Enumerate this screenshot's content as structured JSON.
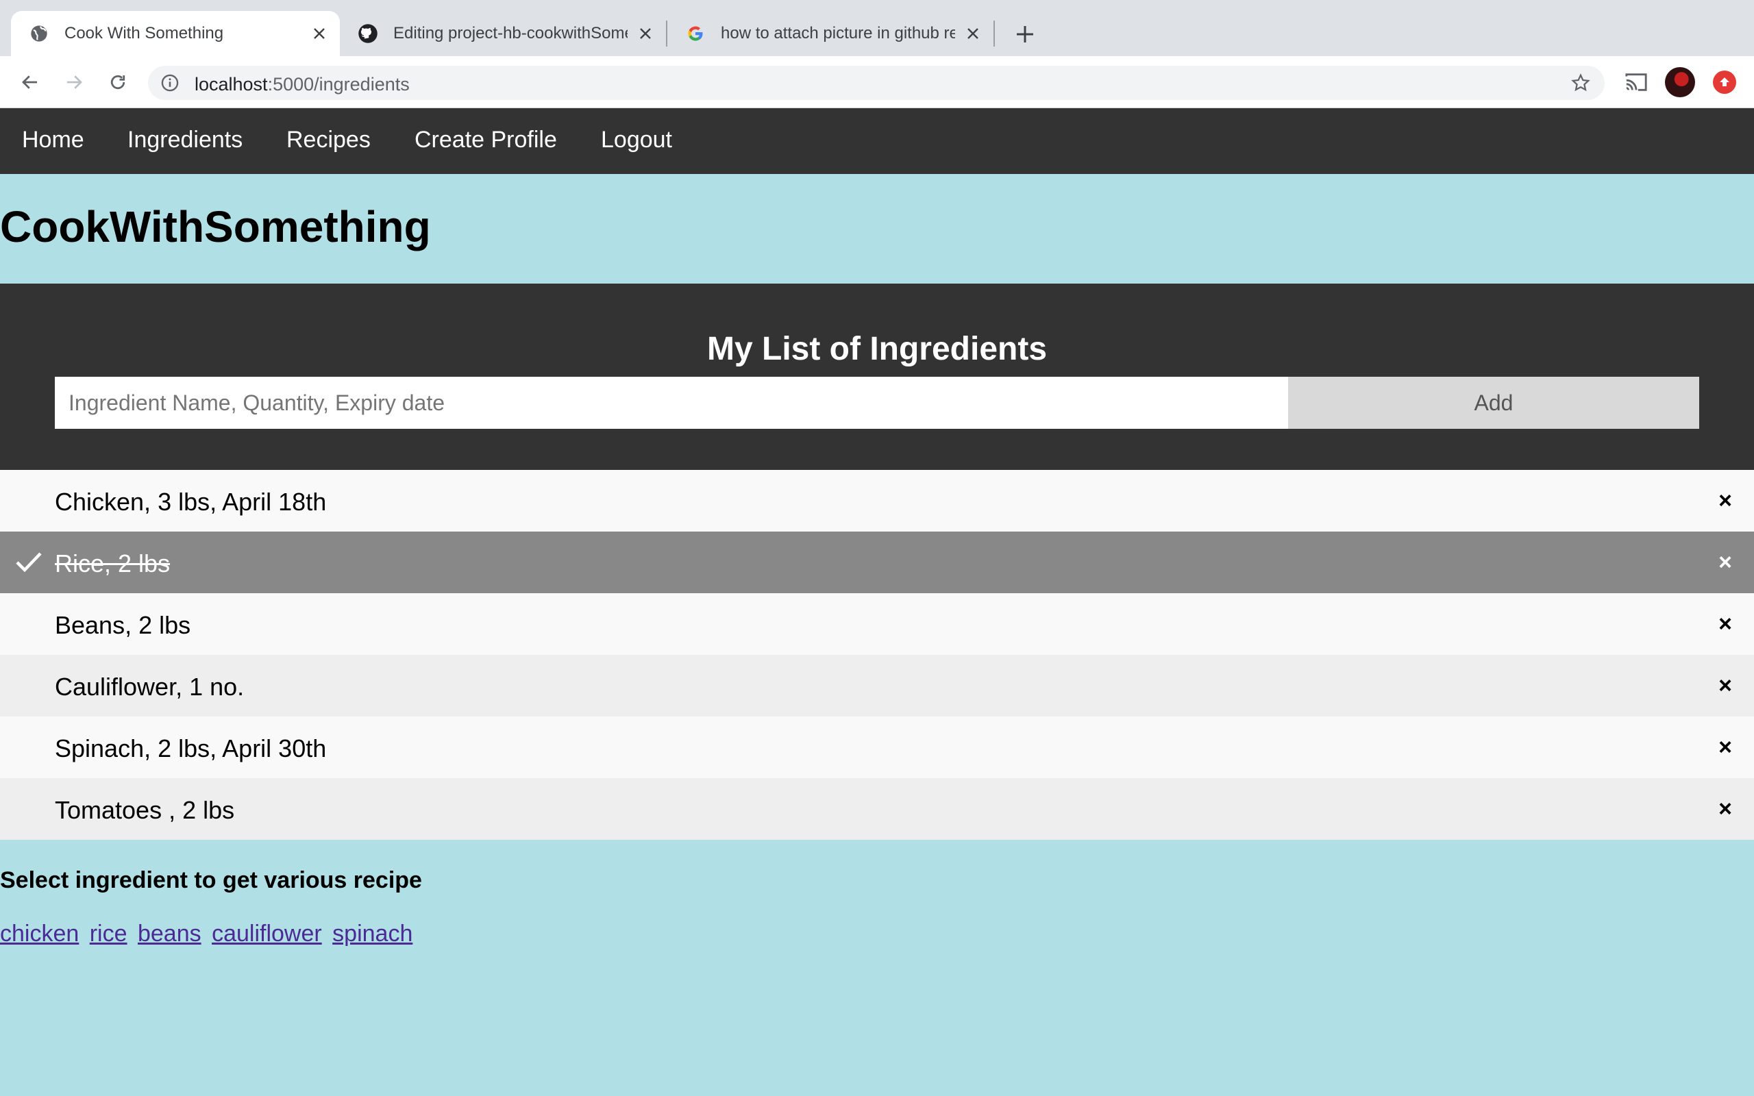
{
  "browser": {
    "tabs": [
      {
        "title": "Cook With Something",
        "icon": "globe-icon",
        "active": true
      },
      {
        "title": "Editing project-hb-cookwithSomething",
        "icon": "github-icon",
        "active": false
      },
      {
        "title": "how to attach picture in github readme",
        "icon": "google-icon",
        "active": false
      }
    ],
    "url_host": "localhost",
    "url_path": ":5000/ingredients"
  },
  "nav": {
    "items": [
      "Home",
      "Ingredients",
      "Recipes",
      "Create Profile",
      "Logout"
    ]
  },
  "brand": "CookWithSomething",
  "ingredients_panel": {
    "heading": "My List of Ingredients",
    "input_placeholder": "Ingredient Name, Quantity, Expiry date",
    "input_value": "",
    "add_label": "Add"
  },
  "ingredients": [
    {
      "text": "Chicken, 3 lbs, April 18th",
      "checked": false
    },
    {
      "text": "Rice, 2 lbs",
      "checked": true
    },
    {
      "text": "Beans, 2 lbs",
      "checked": false
    },
    {
      "text": "Cauliflower, 1 no.",
      "checked": false
    },
    {
      "text": "Spinach, 2 lbs, April 30th",
      "checked": false
    },
    {
      "text": "Tomatoes , 2 lbs",
      "checked": false
    }
  ],
  "close_glyph": "×",
  "recipe_section": {
    "title": "Select ingredient to get various recipe",
    "links": [
      "chicken",
      "rice",
      "beans",
      "cauliflower",
      "spinach"
    ]
  },
  "colors": {
    "navbar": "#333333",
    "page_bg": "#b0dfe5",
    "checked_row": "#888888",
    "link": "#4b2a96"
  }
}
